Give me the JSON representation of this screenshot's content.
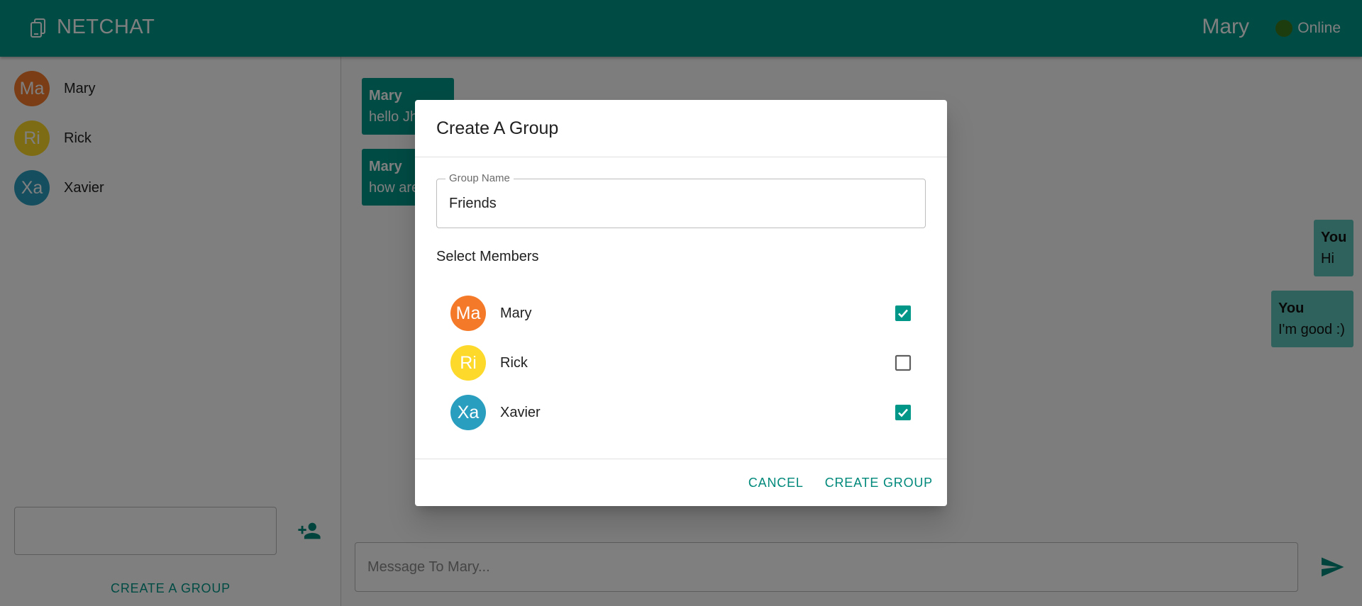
{
  "app": {
    "name": "NETCHAT",
    "user": "Mary",
    "status": "Online"
  },
  "colors": {
    "primary": "#009688",
    "status_dot": "#3d7a1e"
  },
  "sidebar": {
    "contacts": [
      {
        "initials": "Ma",
        "name": "Mary",
        "color": "#f47a2a"
      },
      {
        "initials": "Ri",
        "name": "Rick",
        "color": "#fcd92a"
      },
      {
        "initials": "Xa",
        "name": "Xavier",
        "color": "#2a9ebe"
      }
    ],
    "group_input_value": "",
    "create_group_label": "CREATE A GROUP"
  },
  "chat": {
    "messages": [
      {
        "from": "Mary",
        "text": "hello Jh",
        "side": "them"
      },
      {
        "from": "Mary",
        "text": "how are",
        "side": "them"
      },
      {
        "from": "You",
        "text": "Hi",
        "side": "me"
      },
      {
        "from": "You",
        "text": "I'm good :)",
        "side": "me"
      }
    ],
    "input_placeholder": "Message To Mary..."
  },
  "dialog": {
    "title": "Create A Group",
    "group_name_label": "Group Name",
    "group_name_value": "Friends",
    "select_members_label": "Select Members",
    "members": [
      {
        "initials": "Ma",
        "name": "Mary",
        "checked": true
      },
      {
        "initials": "Ri",
        "name": "Rick",
        "checked": false
      },
      {
        "initials": "Xa",
        "name": "Xavier",
        "checked": true
      }
    ],
    "cancel_label": "CANCEL",
    "create_label": "CREATE GROUP"
  },
  "icons": {
    "brand": "phone-devices-icon",
    "add_person": "person-add-icon",
    "send": "send-icon",
    "checkbox_checked": "checkbox-checked-icon",
    "checkbox_unchecked": "checkbox-unchecked-icon"
  }
}
